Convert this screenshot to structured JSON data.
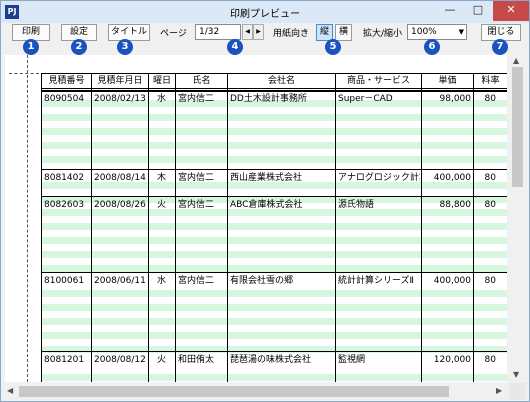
{
  "window": {
    "title": "印刷プレビュー",
    "app_icon": "PJ"
  },
  "toolbar": {
    "print_label": "印刷",
    "settings_label": "設定",
    "title_label": "タイトル",
    "page_label": "ページ",
    "page_value": "1/32",
    "orientation_label": "用紙向き",
    "portrait_label": "縦",
    "landscape_label": "横",
    "zoom_label": "拡大/縮小",
    "zoom_value": "100%",
    "close_label": "閉じる"
  },
  "badges": [
    "1",
    "2",
    "3",
    "4",
    "5",
    "6",
    "7"
  ],
  "table": {
    "headers": [
      "見積番号",
      "見積年月日",
      "曜日",
      "氏名",
      "会社名",
      "商品・サービス",
      "単価",
      "料率"
    ],
    "rows": [
      {
        "id": "8090504",
        "date": "2008/02/13",
        "day": "水",
        "name": "宮内信二",
        "company": "DD土木設計事務所",
        "product": "Super－CAD",
        "price": "98,000",
        "rate": "80"
      },
      {
        "id": "8081402",
        "date": "2008/08/14",
        "day": "木",
        "name": "宮内信二",
        "company": "西山産業株式会社",
        "product": "アナログロジック計算ライ",
        "price": "400,000",
        "rate": "80"
      },
      {
        "id": "8082603",
        "date": "2008/08/26",
        "day": "火",
        "name": "宮内信二",
        "company": "ABC倉庫株式会社",
        "product": "源氏物語",
        "price": "88,800",
        "rate": "80"
      },
      {
        "id": "8100061",
        "date": "2008/06/11",
        "day": "水",
        "name": "宮内信二",
        "company": "有限会社雪の郷",
        "product": "統計計算シリーズⅡ",
        "price": "400,000",
        "rate": "80"
      },
      {
        "id": "8081201",
        "date": "2008/08/12",
        "day": "火",
        "name": "和田侑太",
        "company": "琵琶湯の味株式会社",
        "product": "監視網",
        "price": "120,000",
        "rate": "80"
      }
    ]
  }
}
